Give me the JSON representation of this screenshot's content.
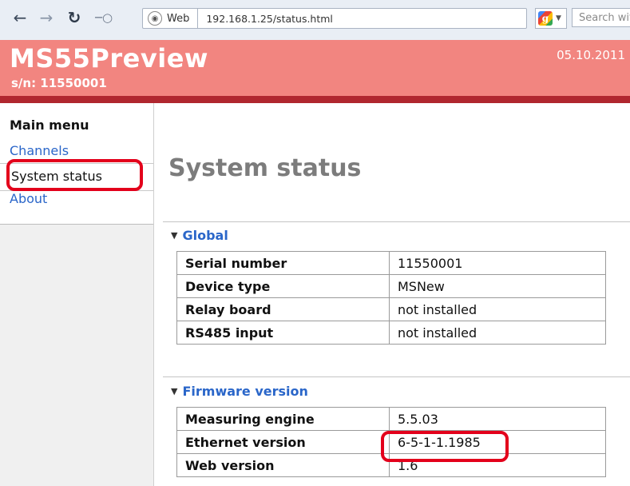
{
  "browser": {
    "url_site_label": "Web",
    "url": "192.168.1.25/status.html",
    "search_placeholder": "Search wit",
    "icons": {
      "back": "back-arrow-icon",
      "forward": "forward-arrow-icon",
      "reload": "reload-icon",
      "key": "key-icon",
      "globe": "globe-icon",
      "search_engine": "google-icon"
    }
  },
  "header": {
    "title": "MS55Preview",
    "serial": "s/n: 11550001",
    "date": "05.10.2011",
    "colors": {
      "background": "#f28580",
      "bar": "#b0272f"
    }
  },
  "sidebar": {
    "title": "Main menu",
    "items": [
      {
        "label": "Channels"
      },
      {
        "label": "System status",
        "active": true
      },
      {
        "label": "About"
      }
    ]
  },
  "main": {
    "title": "System status",
    "sections": [
      {
        "title": "Global",
        "rows": [
          {
            "key": "Serial number",
            "value": "11550001"
          },
          {
            "key": "Device type",
            "value": "MSNew"
          },
          {
            "key": "Relay board",
            "value": "not installed"
          },
          {
            "key": "RS485 input",
            "value": "not installed"
          }
        ]
      },
      {
        "title": "Firmware version",
        "rows": [
          {
            "key": "Measuring engine",
            "value": "5.5.03"
          },
          {
            "key": "Ethernet version",
            "value": "6-5-1-1.1985"
          },
          {
            "key": "Web version",
            "value": "1.6"
          }
        ]
      }
    ]
  },
  "annotations": {
    "highlight_color": "#e3001b"
  }
}
